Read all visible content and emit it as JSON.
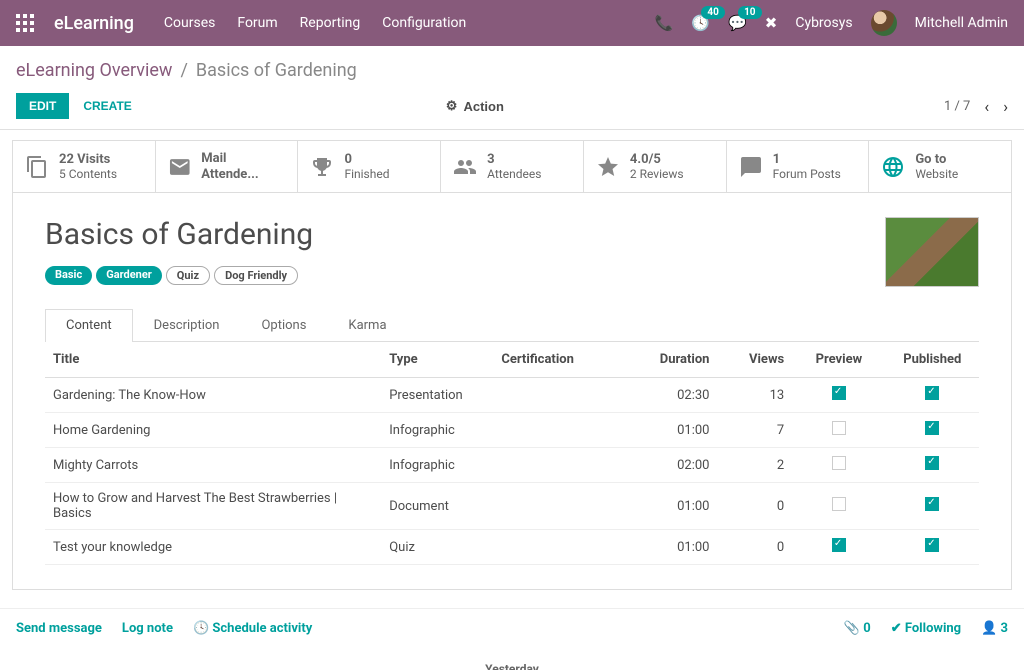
{
  "topbar": {
    "brand": "eLearning",
    "menu": [
      "Courses",
      "Forum",
      "Reporting",
      "Configuration"
    ],
    "badge1": "40",
    "badge2": "10",
    "company": "Cybrosys",
    "user": "Mitchell Admin"
  },
  "breadcrumb": {
    "root": "eLearning Overview",
    "current": "Basics of Gardening"
  },
  "controls": {
    "edit": "EDIT",
    "create": "CREATE",
    "action": "Action",
    "pager": "1 / 7"
  },
  "stats": {
    "visits_n": "22 Visits",
    "visits_l": "5 Contents",
    "mail": "Mail Attende...",
    "finished_n": "0",
    "finished_l": "Finished",
    "att_n": "3",
    "att_l": "Attendees",
    "rev_n": "4.0/5",
    "rev_l": "2 Reviews",
    "forum_n": "1",
    "forum_l": "Forum Posts",
    "web_n": "Go to",
    "web_l": "Website"
  },
  "course": {
    "title": "Basics of Gardening",
    "tags": [
      {
        "label": "Basic",
        "fill": true
      },
      {
        "label": "Gardener",
        "fill": true
      },
      {
        "label": "Quiz",
        "fill": false
      },
      {
        "label": "Dog Friendly",
        "fill": false
      }
    ]
  },
  "tabs": [
    "Content",
    "Description",
    "Options",
    "Karma"
  ],
  "columns": {
    "title": "Title",
    "type": "Type",
    "cert": "Certification",
    "dur": "Duration",
    "views": "Views",
    "prev": "Preview",
    "pub": "Published"
  },
  "rows": [
    {
      "title": "Gardening: The Know-How",
      "type": "Presentation",
      "dur": "02:30",
      "views": "13",
      "prev": true,
      "pub": true
    },
    {
      "title": "Home Gardening",
      "type": "Infographic",
      "dur": "01:00",
      "views": "7",
      "prev": false,
      "pub": true
    },
    {
      "title": "Mighty Carrots",
      "type": "Infographic",
      "dur": "02:00",
      "views": "2",
      "prev": false,
      "pub": true
    },
    {
      "title": "How to Grow and Harvest The Best Strawberries | Basics",
      "type": "Document",
      "dur": "01:00",
      "views": "0",
      "prev": false,
      "pub": true
    },
    {
      "title": "Test your knowledge",
      "type": "Quiz",
      "dur": "01:00",
      "views": "0",
      "prev": true,
      "pub": true
    }
  ],
  "msgbar": {
    "send": "Send message",
    "log": "Log note",
    "sched": "Schedule activity",
    "attach": "0",
    "follow": "Following",
    "followers": "3"
  },
  "divider": "Yesterday"
}
